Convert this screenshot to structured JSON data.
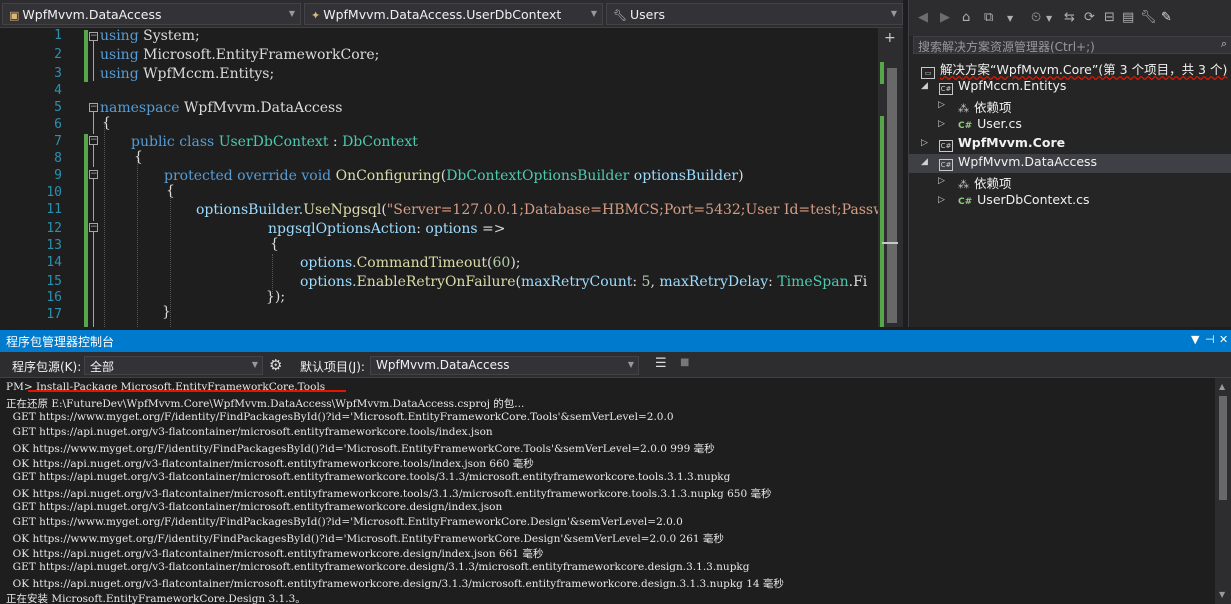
{
  "editor": {
    "nav": {
      "project": "WpfMvvm.DataAccess",
      "class": "WpfMvvm.DataAccess.UserDbContext",
      "member": "Users"
    },
    "line_numbers": [
      "1",
      "2",
      "3",
      "4",
      "5",
      "6",
      "7",
      "8",
      "9",
      "10",
      "11",
      "12",
      "13",
      "14",
      "15",
      "16",
      "17"
    ],
    "split_label": "+"
  },
  "code": {
    "l1": {
      "kw": "using",
      "rest": " System;"
    },
    "l2": {
      "kw": "using",
      "rest": " Microsoft.EntityFrameworkCore;"
    },
    "l3": {
      "kw": "using",
      "rest": " WpfMccm.Entitys;"
    },
    "l5": {
      "kw": "namespace",
      "rest": " WpfMvvm.DataAccess"
    },
    "l6": "{",
    "l7": {
      "kw1": "public",
      "kw2": "class",
      "name": "UserDbContext",
      "sep": " : ",
      "base": "DbContext"
    },
    "l8": "{",
    "l9": {
      "kw1": "protected",
      "kw2": "override",
      "kw3": "void",
      "fn": "OnConfiguring",
      "open": "(",
      "ptype": "DbContextOptionsBuilder",
      "pname": " optionsBuilder",
      "close": ")"
    },
    "l10": "{",
    "l11": {
      "obj": "optionsBuilder.",
      "fn": "UseNpgsql",
      "open": "(",
      "str": "\"Server=127.0.0.1;Database=HBMCS;Port=5432;User Id=test;Passw"
    },
    "l12": {
      "param": "npgsqlOptionsAction",
      "colon": ": ",
      "arg": "options",
      "arrow": " =>"
    },
    "l13": "{",
    "l14": {
      "obj": "options.",
      "fn": "CommandTimeout",
      "open": "(",
      "num": "60",
      "close": ");"
    },
    "l15": {
      "obj": "options.",
      "fn": "EnableRetryOnFailure",
      "open": "(",
      "p1": "maxRetryCount",
      "c1": ": ",
      "n1": "5",
      "c2": ", ",
      "p2": "maxRetryDelay",
      "c3": ": ",
      "ty": "TimeSpan",
      "tail": ".Fi"
    },
    "l16": "});",
    "l17": "}"
  },
  "solution_explorer": {
    "search_placeholder": "搜索解决方案资源管理器(Ctrl+;)",
    "solution": "解决方案“WpfMvvm.Core”(第 3 个项目，共 3 个)",
    "items": [
      {
        "label": "WpfMccm.Entitys"
      },
      {
        "label": "依赖项"
      },
      {
        "label": "User.cs"
      },
      {
        "label": "WpfMvvm.Core"
      },
      {
        "label": "WpfMvvm.DataAccess"
      },
      {
        "label": "依赖项"
      },
      {
        "label": "UserDbContext.cs"
      }
    ],
    "csharp_badge": "C#",
    "proj_badge": "C#"
  },
  "pmc": {
    "title": "程序包管理器控制台",
    "source_label": "程序包源(K):",
    "source_value": "全部",
    "default_project_label": "默认项目(J):",
    "default_project_value": "WpfMvvm.DataAccess",
    "lines": [
      "PM> Install-Package Microsoft.EntityFrameworkCore.Tools",
      "正在还原 E:\\FutureDev\\WpfMvvm.Core\\WpfMvvm.DataAccess\\WpfMvvm.DataAccess.csproj 的包...",
      "  GET https://www.myget.org/F/identity/FindPackagesById()?id='Microsoft.EntityFrameworkCore.Tools'&semVerLevel=2.0.0",
      "  GET https://api.nuget.org/v3-flatcontainer/microsoft.entityframeworkcore.tools/index.json",
      "  OK https://www.myget.org/F/identity/FindPackagesById()?id='Microsoft.EntityFrameworkCore.Tools'&semVerLevel=2.0.0 999 毫秒",
      "  OK https://api.nuget.org/v3-flatcontainer/microsoft.entityframeworkcore.tools/index.json 660 毫秒",
      "  GET https://api.nuget.org/v3-flatcontainer/microsoft.entityframeworkcore.tools/3.1.3/microsoft.entityframeworkcore.tools.3.1.3.nupkg",
      "  OK https://api.nuget.org/v3-flatcontainer/microsoft.entityframeworkcore.tools/3.1.3/microsoft.entityframeworkcore.tools.3.1.3.nupkg 650 毫秒",
      "  GET https://api.nuget.org/v3-flatcontainer/microsoft.entityframeworkcore.design/index.json",
      "  GET https://www.myget.org/F/identity/FindPackagesById()?id='Microsoft.EntityFrameworkCore.Design'&semVerLevel=2.0.0",
      "  OK https://www.myget.org/F/identity/FindPackagesById()?id='Microsoft.EntityFrameworkCore.Design'&semVerLevel=2.0.0 261 毫秒",
      "  OK https://api.nuget.org/v3-flatcontainer/microsoft.entityframeworkcore.design/index.json 661 毫秒",
      "  GET https://api.nuget.org/v3-flatcontainer/microsoft.entityframeworkcore.design/3.1.3/microsoft.entityframeworkcore.design.3.1.3.nupkg",
      "  OK https://api.nuget.org/v3-flatcontainer/microsoft.entityframeworkcore.design/3.1.3/microsoft.entityframeworkcore.design.3.1.3.nupkg 14 毫秒",
      "正在安装 Microsoft.EntityFrameworkCore.Design 3.1.3。"
    ]
  },
  "colors": {
    "accent": "#007acc",
    "keyword": "#569cd6",
    "type": "#4ec9b0",
    "method": "#dcdcaa",
    "string": "#d69d85",
    "changebar": "#57a64a"
  }
}
